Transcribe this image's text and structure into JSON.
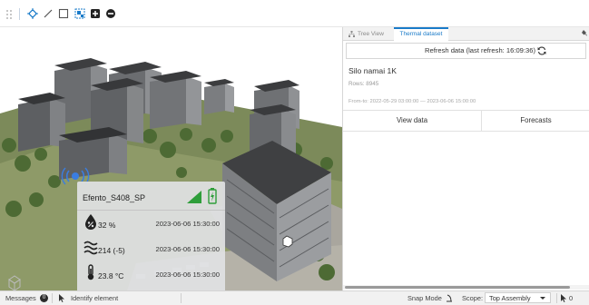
{
  "toolbar": {
    "tools": [
      {
        "name": "select-tool",
        "icon": "cursor-target-icon",
        "active": true
      },
      {
        "name": "line-tool",
        "icon": "line-icon"
      },
      {
        "name": "rectangle-tool",
        "icon": "square-icon"
      },
      {
        "name": "region-select-tool",
        "icon": "region-select-icon"
      },
      {
        "name": "zoom-in-tool",
        "icon": "plus-square-icon"
      },
      {
        "name": "zoom-out-tool",
        "icon": "minus-circle-icon"
      }
    ]
  },
  "sensor_card": {
    "name": "Efento_S408_SP",
    "readings": [
      {
        "icon": "humidity-drop-icon",
        "value": "32 %",
        "timestamp": "2023-06-06 15:30:00"
      },
      {
        "icon": "air-waves-icon",
        "value": "214 (-5)",
        "timestamp": "2023-06-06 15:30:00"
      },
      {
        "icon": "thermometer-icon",
        "value": "23.8 °C",
        "timestamp": "2023-06-06 15:30:00"
      }
    ]
  },
  "panel": {
    "tabs": [
      {
        "label": "Tree View",
        "active": false
      },
      {
        "label": "Thermal dataset",
        "active": true
      }
    ],
    "refresh_label": "Refresh data (last refresh: 16:09:36)",
    "dataset_title": "Silo namai 1K",
    "rows": "Rows: 8945",
    "range": "From-to: 2022-05-29 03:00:00 — 2023-06-06 15:00:00",
    "view_data_label": "View data",
    "forecasts_label": "Forecasts"
  },
  "statusbar": {
    "messages_label": "Messages",
    "messages_count": "0",
    "identify_label": "Identify element",
    "snap_mode_label": "Snap Mode",
    "scope_label": "Scope:",
    "scope_value": "Top Assembly",
    "selection_count": "0"
  },
  "colors": {
    "accent": "#1a7bc9",
    "signal_green": "#2e9e3a",
    "battery_green": "#2e9e3a",
    "sensor_blue": "#3a7de0"
  }
}
